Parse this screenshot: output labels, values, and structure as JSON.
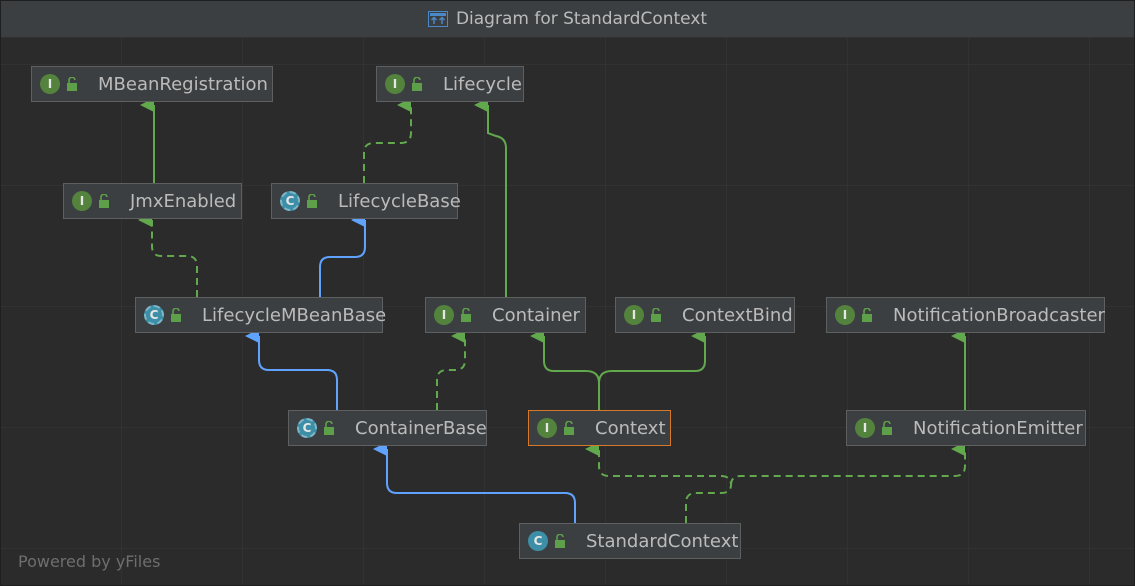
{
  "window": {
    "title": "Diagram for StandardContext",
    "title_icon": "diagram-icon"
  },
  "colors": {
    "interface_badge": "#53833d",
    "class_badge": "#3d8fa8",
    "extends_edge": "#6aa3ff",
    "implements_edge": "#62a84d",
    "selected_border": "#d6792b"
  },
  "nodes": {
    "mbeanregistration": {
      "label": "MBeanRegistration",
      "kind": "interface",
      "badge": "I"
    },
    "lifecycle": {
      "label": "Lifecycle",
      "kind": "interface",
      "badge": "I"
    },
    "jmxenabled": {
      "label": "JmxEnabled",
      "kind": "interface",
      "badge": "I"
    },
    "lifecyclebase": {
      "label": "LifecycleBase",
      "kind": "abstract-class",
      "badge": "C"
    },
    "lifecyclembeanbase": {
      "label": "LifecycleMBeanBase",
      "kind": "abstract-class",
      "badge": "C"
    },
    "container": {
      "label": "Container",
      "kind": "interface",
      "badge": "I"
    },
    "contextbind": {
      "label": "ContextBind",
      "kind": "interface",
      "badge": "I"
    },
    "notificationbroadcaster": {
      "label": "NotificationBroadcaster",
      "kind": "interface",
      "badge": "I"
    },
    "containerbase": {
      "label": "ContainerBase",
      "kind": "abstract-class",
      "badge": "C"
    },
    "context": {
      "label": "Context",
      "kind": "interface",
      "badge": "I",
      "selected": true
    },
    "notificationemitter": {
      "label": "NotificationEmitter",
      "kind": "interface",
      "badge": "I"
    },
    "standardcontext": {
      "label": "StandardContext",
      "kind": "class",
      "badge": "C"
    }
  },
  "edges": [
    {
      "from": "JmxEnabled",
      "to": "MBeanRegistration",
      "type": "interface-extends"
    },
    {
      "from": "LifecycleBase",
      "to": "Lifecycle",
      "type": "implements"
    },
    {
      "from": "Container",
      "to": "Lifecycle",
      "type": "interface-extends"
    },
    {
      "from": "LifecycleMBeanBase",
      "to": "JmxEnabled",
      "type": "implements"
    },
    {
      "from": "LifecycleMBeanBase",
      "to": "LifecycleBase",
      "type": "extends"
    },
    {
      "from": "ContainerBase",
      "to": "LifecycleMBeanBase",
      "type": "extends"
    },
    {
      "from": "ContainerBase",
      "to": "Container",
      "type": "implements"
    },
    {
      "from": "Context",
      "to": "Container",
      "type": "interface-extends"
    },
    {
      "from": "Context",
      "to": "ContextBind",
      "type": "interface-extends"
    },
    {
      "from": "NotificationEmitter",
      "to": "NotificationBroadcaster",
      "type": "interface-extends"
    },
    {
      "from": "StandardContext",
      "to": "ContainerBase",
      "type": "extends"
    },
    {
      "from": "StandardContext",
      "to": "Context",
      "type": "implements"
    },
    {
      "from": "StandardContext",
      "to": "NotificationEmitter",
      "type": "implements"
    }
  ],
  "footer": {
    "powered_by": "Powered by yFiles"
  }
}
